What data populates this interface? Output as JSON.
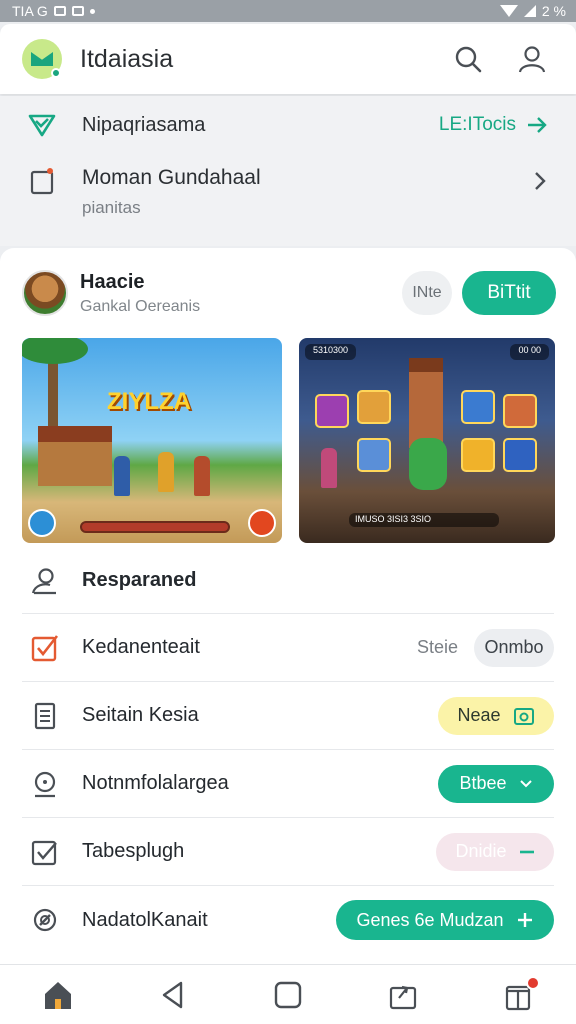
{
  "status_bar": {
    "left_text": "TIA G",
    "right_text": "2 %"
  },
  "app_bar": {
    "title": "Itdaiasia",
    "logo_icon": "app-logo",
    "actions": [
      "search-icon",
      "profile-icon"
    ]
  },
  "promo_row": {
    "text": "Nipaqriasama",
    "link": "LE:ITocis"
  },
  "subscription_row": {
    "title": "Moman Gundahaal",
    "subtitle": "pianitas"
  },
  "game": {
    "name": "Haacie",
    "developer": "Gankal Oereanis",
    "secondary_button": "INte",
    "install_button": "BiTtit",
    "screenshot_1_title": "ZIYLZA",
    "screenshot_2_hud_left": "5310300",
    "screenshot_2_hud_right": "00 00",
    "screenshot_2_hud_bottom": "IMUSO 3ISI3 3SIO"
  },
  "list": {
    "items": [
      {
        "label": "Resparaned",
        "icon": "person-icon"
      },
      {
        "label": "Kedanenteait",
        "icon": "checkbox-icon",
        "meta": "Steie",
        "chip": "Onmbo"
      },
      {
        "label": "Seitain Kesia",
        "icon": "document-icon",
        "chip": "Neae"
      },
      {
        "label": "Notnmfolalargea",
        "icon": "chat-icon",
        "chip": "Btbee"
      },
      {
        "label": "Tabesplugh",
        "icon": "checkbox-icon",
        "chip": "Dnidie"
      },
      {
        "label": "NadatolKanait",
        "icon": "link-icon",
        "chip": "Genes 6e Mudzan"
      }
    ]
  },
  "colors": {
    "accent": "#19b58f",
    "chip_yellow": "#fbf3a8",
    "chip_pink": "#f5e6ec",
    "badge": "#e23b2f"
  },
  "nav_bar": {
    "buttons": [
      "home-icon",
      "back-icon",
      "overview-icon",
      "share-icon",
      "inbox-icon"
    ]
  }
}
